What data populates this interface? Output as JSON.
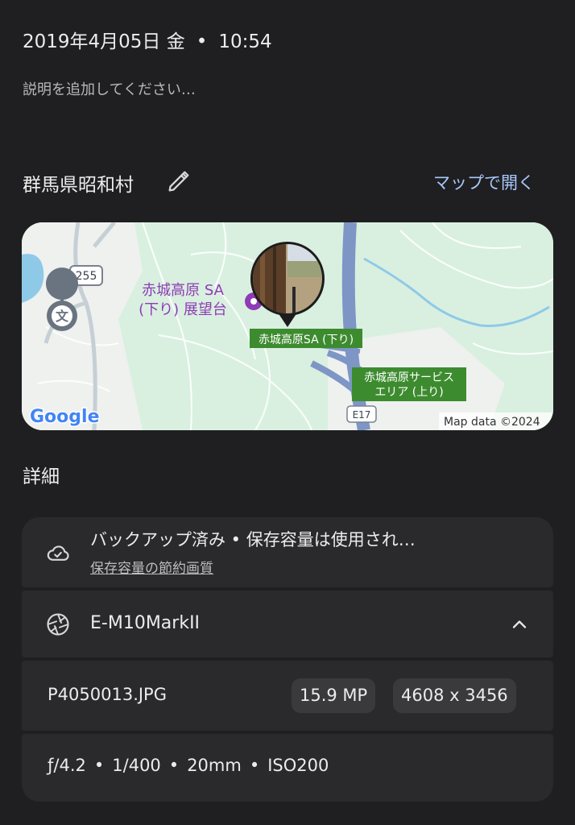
{
  "header": {
    "date": "2019年4月05日 金",
    "separator": "•",
    "time": "10:54",
    "description_placeholder": "説明を追加してください…"
  },
  "location": {
    "name": "群馬県昭和村",
    "open_map_label": "マップで開く"
  },
  "map": {
    "road_shield": "255",
    "expressway": "E17",
    "poi_observatory": [
      "赤城高原 SA",
      "(下り) 展望台"
    ],
    "poi_sa_down": "赤城高原SA (下り)",
    "poi_sa_up": [
      "赤城高原サービス",
      "エリア (上り)"
    ],
    "logo": "Google",
    "attribution": "Map data ©2024",
    "school_symbol": "文"
  },
  "details": {
    "heading": "詳細",
    "backup": {
      "title": "バックアップ済み • 保存容量は使用され…",
      "quality_link": "保存容量の節約画質"
    },
    "camera": {
      "model": "E-M10MarkII"
    },
    "file": {
      "name": "P4050013.JPG",
      "megapixels": "15.9 MP",
      "resolution": "4608 x 3456"
    },
    "exif": {
      "aperture": "ƒ/4.2",
      "shutter": "1/400",
      "focal_length": "20mm",
      "iso": "ISO200"
    }
  },
  "colors": {
    "background": "#1f1f21",
    "card": "#2a2a2c",
    "accent_link": "#a8c7fa",
    "map_land": "#d9f0e0",
    "map_water": "#8fc9e8",
    "map_label_green": "#3d8b2f",
    "map_poi_purple": "#8e3bb5"
  }
}
